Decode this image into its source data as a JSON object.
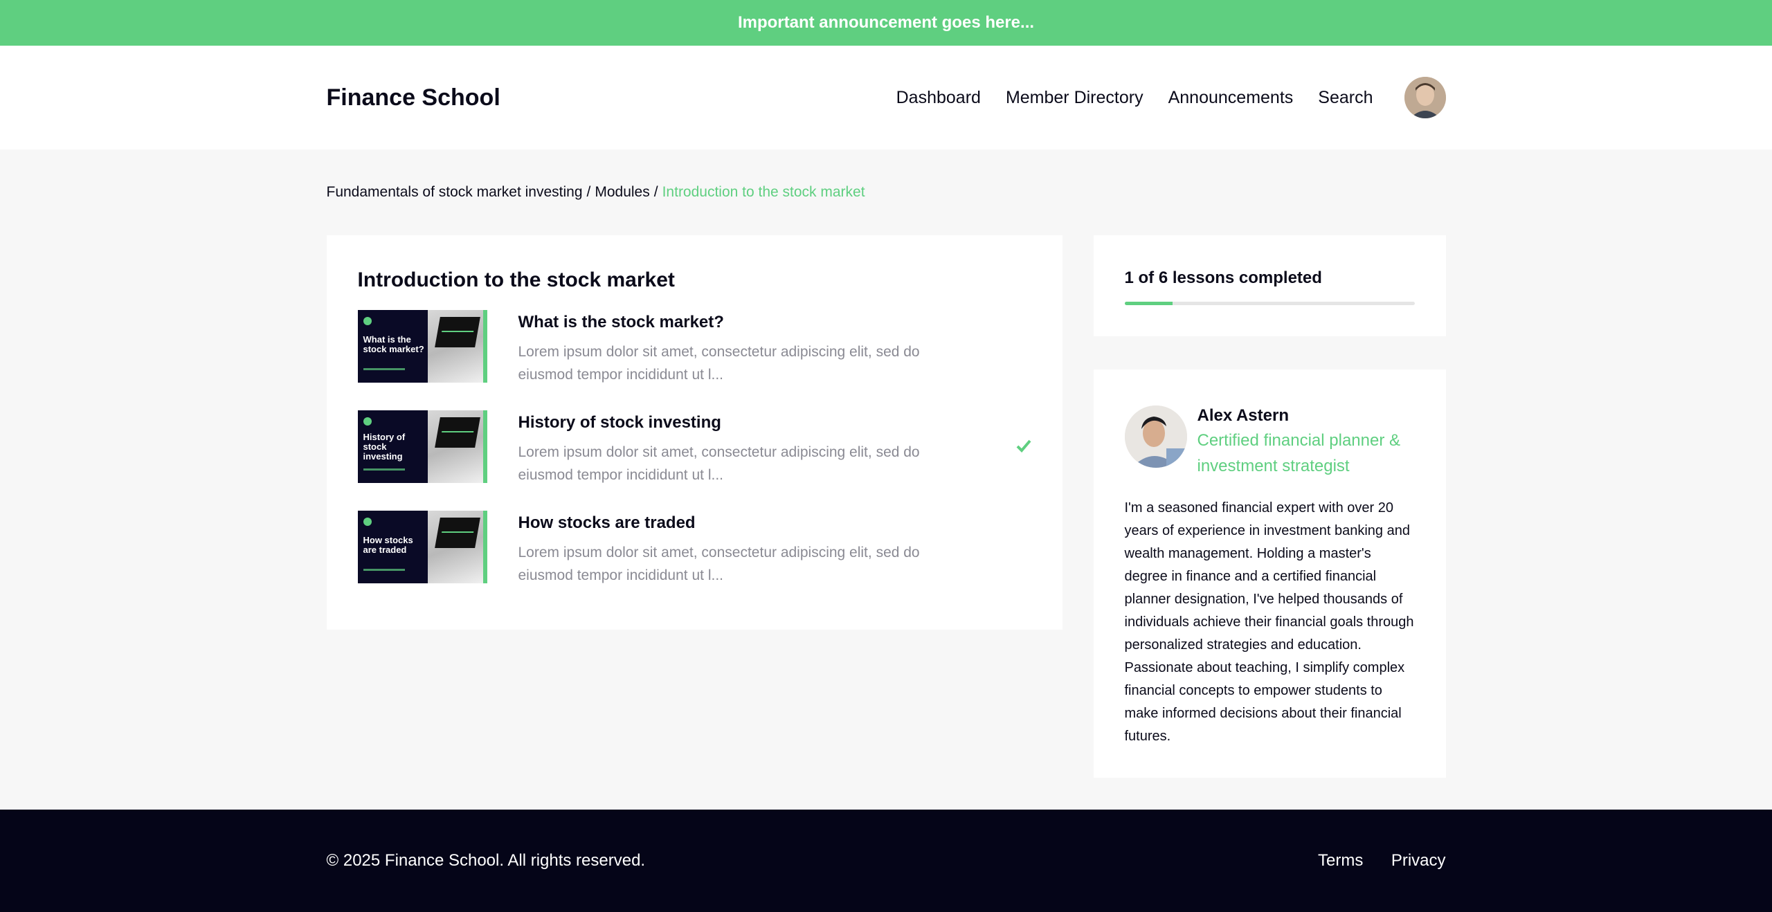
{
  "announcement": "Important announcement goes here...",
  "header": {
    "brand": "Finance School",
    "nav": [
      "Dashboard",
      "Member Directory",
      "Announcements",
      "Search"
    ]
  },
  "breadcrumb": {
    "course": "Fundamentals of stock market investing",
    "section": "Modules",
    "current": "Introduction to the stock market",
    "separator": "/"
  },
  "module": {
    "title": "Introduction to the stock market",
    "lessons": [
      {
        "title": "What is the stock market?",
        "thumb_title": "What is the stock market?",
        "description": "Lorem ipsum dolor sit amet, consectetur adipiscing elit, sed do eiusmod tempor incididunt ut l...",
        "completed": false
      },
      {
        "title": "History of stock investing",
        "thumb_title": "History of stock investing",
        "description": "Lorem ipsum dolor sit amet, consectetur adipiscing elit, sed do eiusmod tempor incididunt ut l...",
        "completed": true
      },
      {
        "title": "How stocks are traded",
        "thumb_title": "How stocks are traded",
        "description": "Lorem ipsum dolor sit amet, consectetur adipiscing elit, sed do eiusmod tempor incididunt ut l...",
        "completed": false
      }
    ]
  },
  "progress": {
    "label": "1 of 6 lessons completed",
    "completed": 1,
    "total": 6
  },
  "author": {
    "name": "Alex Astern",
    "role": "Certified financial planner & investment strategist",
    "bio": "I'm a seasoned financial expert with over 20 years of experience in investment banking and wealth management. Holding a master's degree in finance and a certified financial planner designation, I've helped thousands of individuals achieve their financial goals through personalized strategies and education. Passionate about teaching, I simplify complex financial concepts to empower students to make informed decisions about their financial futures."
  },
  "footer": {
    "copyright": "© 2025 Finance School. All rights reserved.",
    "links": [
      "Terms",
      "Privacy"
    ]
  },
  "colors": {
    "accent": "#5fcf80",
    "dark": "#050518",
    "text": "#0b0b1a",
    "muted": "#8a8a93"
  },
  "icons": {
    "check": "check-icon",
    "avatar": "user-avatar",
    "author_photo": "author-photo"
  }
}
